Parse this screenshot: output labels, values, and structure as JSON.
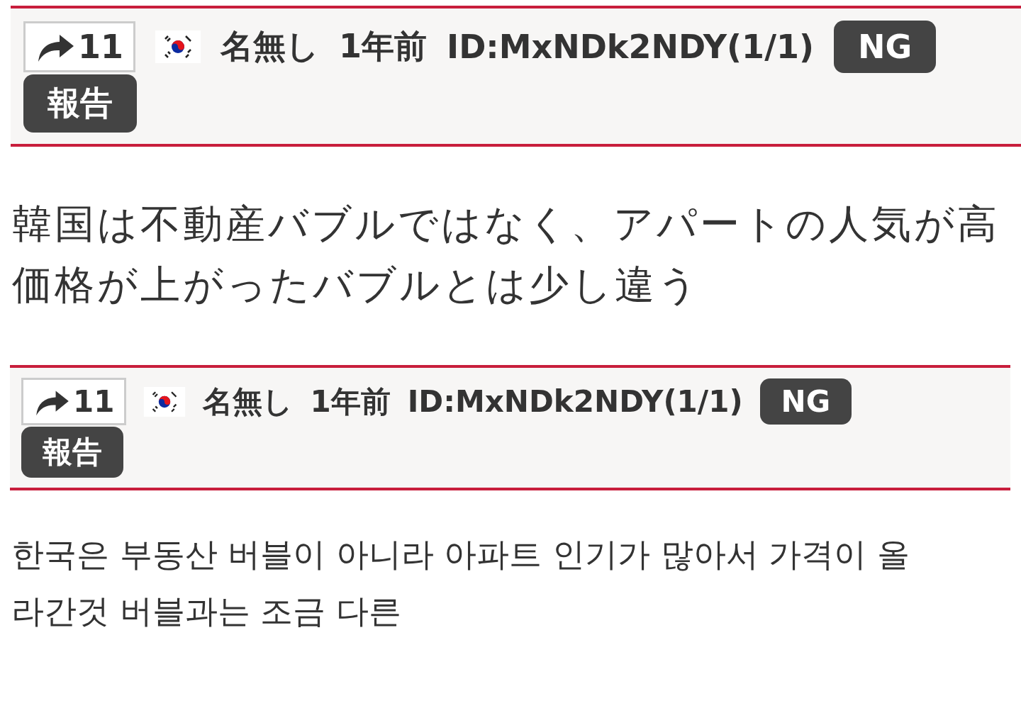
{
  "posts": [
    {
      "share_count": "11",
      "name": "名無し",
      "time": "1年前",
      "user_id": "ID:MxNDk2NDY(1/1)",
      "ng_button": "NG",
      "report_button": "報告",
      "body_lines": [
        "韓国は不動産バブルではなく、アパートの人気が高",
        "価格が上がったバブルとは少し違う"
      ]
    },
    {
      "share_count": "11",
      "name": "名無し",
      "time": "1年前",
      "user_id": "ID:MxNDk2NDY(1/1)",
      "ng_button": "NG",
      "report_button": "報告",
      "body_lines": [
        "한국은 부동산 버블이 아니라 아파트 인기가 많아서 가격이 올",
        "라간것 버블과는 조금 다른"
      ]
    }
  ]
}
